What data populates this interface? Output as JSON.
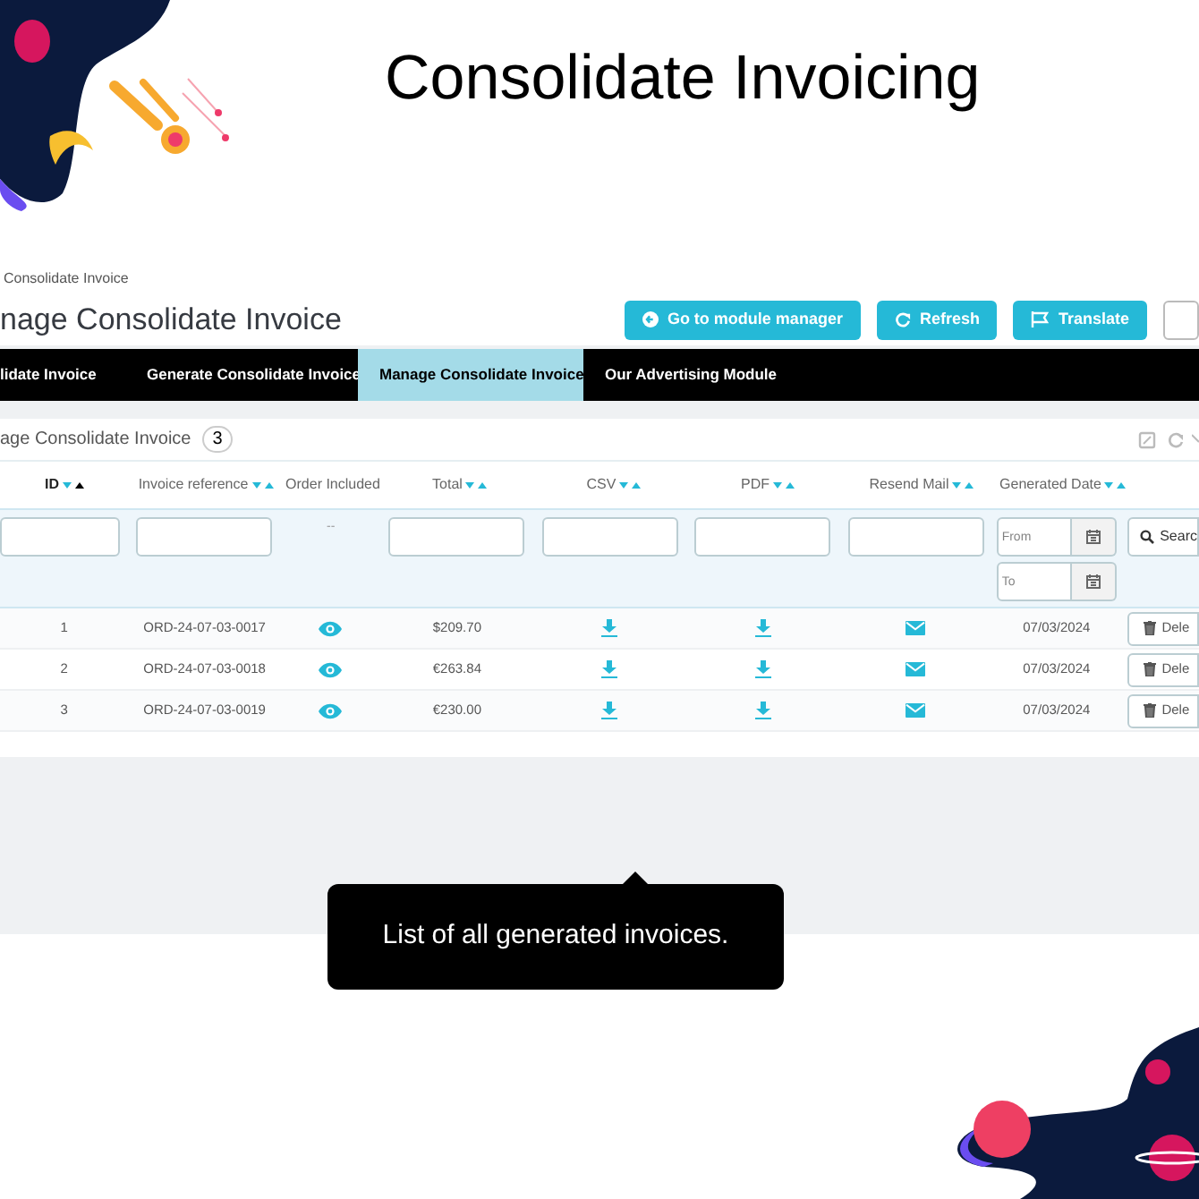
{
  "title": "Consolidate Invoicing",
  "breadcrumb": "Consolidate Invoice",
  "page_title": "nage Consolidate Invoice",
  "toolbar": [
    {
      "label": "Go to module manager",
      "kind": "back"
    },
    {
      "label": "Refresh",
      "kind": "refresh"
    },
    {
      "label": "Translate",
      "kind": "flag"
    },
    {
      "kind": "blank"
    }
  ],
  "tabs": [
    {
      "label": "lidate Invoice",
      "selected": false
    },
    {
      "label": "Generate Consolidate Invoice",
      "selected": false
    },
    {
      "label": "Manage Consolidate Invoice",
      "selected": true
    },
    {
      "label": "Our Advertising Module",
      "selected": false
    }
  ],
  "panel": {
    "title": "age Consolidate Invoice",
    "count": "3"
  },
  "columns": [
    {
      "label": "ID",
      "sortable": true,
      "sorted_ascending": true
    },
    {
      "label": "Invoice reference",
      "sortable": true,
      "sorted_ascending": false
    },
    {
      "label": "Order Included",
      "sortable": false,
      "sorted_ascending": false
    },
    {
      "label": "Total",
      "sortable": true,
      "sorted_ascending": false
    },
    {
      "label": "CSV",
      "sortable": true,
      "sorted_ascending": false
    },
    {
      "label": "PDF",
      "sortable": true,
      "sorted_ascending": false
    },
    {
      "label": "Resend Mail",
      "sortable": true,
      "sorted_ascending": false
    },
    {
      "label": "Generated Date",
      "sortable": true,
      "sorted_ascending": false
    }
  ],
  "filters": [
    {
      "kind": "text"
    },
    {
      "kind": "text"
    },
    {
      "kind": "none",
      "text": "--"
    },
    {
      "kind": "text"
    },
    {
      "kind": "text"
    },
    {
      "kind": "text"
    },
    {
      "kind": "text"
    },
    {
      "kind": "date",
      "from_placeholder": "From",
      "to_placeholder": "To"
    }
  ],
  "search_button": "Searc",
  "rows": [
    {
      "id": "1",
      "reference": "ORD-24-07-03-0017",
      "total": "$209.70",
      "date": "07/03/2024",
      "delete": "Dele"
    },
    {
      "id": "2",
      "reference": "ORD-24-07-03-0018",
      "total": "€263.84",
      "date": "07/03/2024",
      "delete": "Dele"
    },
    {
      "id": "3",
      "reference": "ORD-24-07-03-0019",
      "total": "€230.00",
      "date": "07/03/2024",
      "delete": "Dele"
    }
  ],
  "callout": "List of all generated invoices."
}
